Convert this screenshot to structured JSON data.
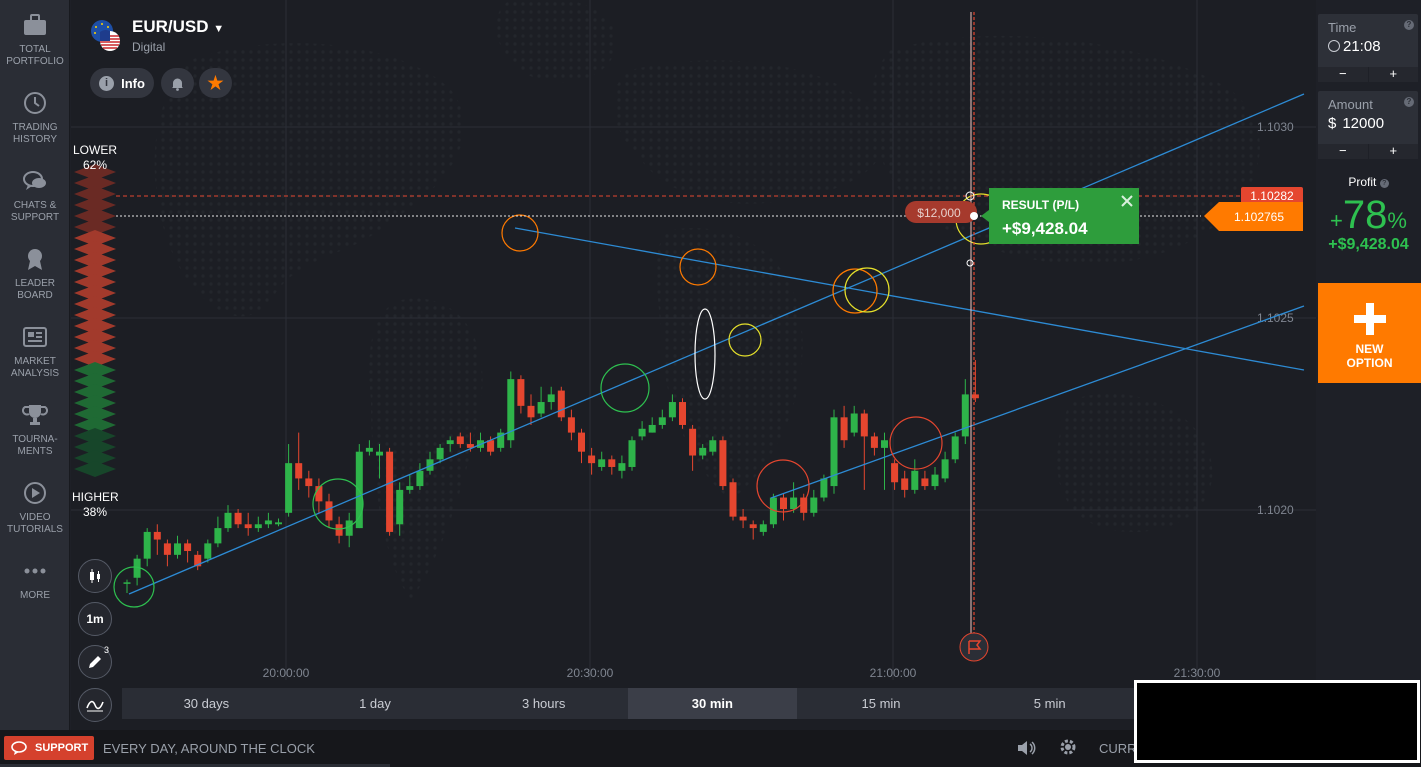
{
  "sidebar": {
    "items": [
      {
        "label": "Total Portfolio",
        "icon": "briefcase-icon"
      },
      {
        "label": "Trading History",
        "icon": "history-icon"
      },
      {
        "label": "Chats & Support",
        "icon": "chat-icon"
      },
      {
        "label": "Leader Board",
        "icon": "medal-icon"
      },
      {
        "label": "Market Analysis",
        "icon": "newspaper-icon"
      },
      {
        "label": "Tourna-ments",
        "icon": "trophy-icon"
      },
      {
        "label": "Video Tutorials",
        "icon": "play-icon"
      },
      {
        "label": "More",
        "icon": "more-icon"
      }
    ]
  },
  "asset": {
    "name": "EUR/USD",
    "type": "Digital",
    "info_label": "Info"
  },
  "sentiment": {
    "lower_label": "LOWER",
    "lower_pct": "62%",
    "higher_label": "HIGHER",
    "higher_pct": "38%"
  },
  "chart_tools": {
    "interval": "1m",
    "drawing_count": "3"
  },
  "price_axis": {
    "labels": [
      "1.1030",
      "1.1025",
      "1.1020"
    ],
    "strike_price": "1.10282",
    "current_price": "1.102765"
  },
  "time_axis": {
    "labels": [
      "20:00:00",
      "20:30:00",
      "21:00:00",
      "21:30:00"
    ]
  },
  "trade": {
    "amount_tag": "$12,000",
    "result_label": "RESULT (P/L)",
    "result_value": "+$9,428.04"
  },
  "right_panel": {
    "time_title": "Time",
    "time_value": "21:08",
    "amount_title": "Amount",
    "amount_currency": "$",
    "amount_value": "12000",
    "minus": "−",
    "plus": "+",
    "profit_title": "Profit",
    "profit_pct": "78",
    "profit_pct_sign": "%",
    "profit_plus": "+",
    "profit_value": "+$9,428.04",
    "new_option_label": "NEW OPTION"
  },
  "timeframes": [
    {
      "label": "30 days",
      "active": false
    },
    {
      "label": "1 day",
      "active": false
    },
    {
      "label": "3 hours",
      "active": false
    },
    {
      "label": "30 min",
      "active": true
    },
    {
      "label": "15 min",
      "active": false
    },
    {
      "label": "5 min",
      "active": false
    }
  ],
  "footer": {
    "support_label": "SUPPORT",
    "tagline": "EVERY DAY, AROUND THE CLOCK",
    "currency_label": "CURR"
  },
  "colors": {
    "up": "#2eb44a",
    "down": "#e5462f",
    "accent": "#ff7a00",
    "profit": "#2ec150",
    "trendline": "#2d8bd4"
  },
  "chart_data": {
    "type": "candlestick",
    "ylim": [
      1.10165,
      1.10345
    ],
    "candles": [
      {
        "o": 1.101805,
        "c": 1.101808,
        "h": 1.101815,
        "l": 1.10178
      },
      {
        "o": 1.10182,
        "c": 1.10187,
        "h": 1.10188,
        "l": 1.1018
      },
      {
        "o": 1.10187,
        "c": 1.10194,
        "h": 1.10195,
        "l": 1.10185
      },
      {
        "o": 1.10194,
        "c": 1.10192,
        "h": 1.10196,
        "l": 1.10188
      },
      {
        "o": 1.10191,
        "c": 1.10188,
        "h": 1.10192,
        "l": 1.10185
      },
      {
        "o": 1.10188,
        "c": 1.10191,
        "h": 1.10193,
        "l": 1.10187
      },
      {
        "o": 1.10191,
        "c": 1.10189,
        "h": 1.10192,
        "l": 1.10186
      },
      {
        "o": 1.10188,
        "c": 1.10185,
        "h": 1.10189,
        "l": 1.10184
      },
      {
        "o": 1.10187,
        "c": 1.10191,
        "h": 1.10192,
        "l": 1.10186
      },
      {
        "o": 1.10191,
        "c": 1.10195,
        "h": 1.10198,
        "l": 1.1019
      },
      {
        "o": 1.10195,
        "c": 1.10199,
        "h": 1.10201,
        "l": 1.10194
      },
      {
        "o": 1.10199,
        "c": 1.10196,
        "h": 1.102,
        "l": 1.10195
      },
      {
        "o": 1.10196,
        "c": 1.10195,
        "h": 1.10199,
        "l": 1.10193
      },
      {
        "o": 1.10195,
        "c": 1.10196,
        "h": 1.10198,
        "l": 1.10194
      },
      {
        "o": 1.10196,
        "c": 1.10197,
        "h": 1.10199,
        "l": 1.10195
      },
      {
        "o": 1.10196,
        "c": 1.101965,
        "h": 1.101975,
        "l": 1.101955
      },
      {
        "o": 1.10199,
        "c": 1.10212,
        "h": 1.10217,
        "l": 1.10198
      },
      {
        "o": 1.10212,
        "c": 1.10208,
        "h": 1.1022,
        "l": 1.10205
      },
      {
        "o": 1.10208,
        "c": 1.10206,
        "h": 1.1021,
        "l": 1.10203
      },
      {
        "o": 1.10206,
        "c": 1.10202,
        "h": 1.10208,
        "l": 1.10199
      },
      {
        "o": 1.10202,
        "c": 1.10197,
        "h": 1.10204,
        "l": 1.10195
      },
      {
        "o": 1.10196,
        "c": 1.10193,
        "h": 1.10198,
        "l": 1.10191
      },
      {
        "o": 1.10193,
        "c": 1.10197,
        "h": 1.10199,
        "l": 1.1019
      },
      {
        "o": 1.10195,
        "c": 1.10215,
        "h": 1.10217,
        "l": 1.10195
      },
      {
        "o": 1.10215,
        "c": 1.10216,
        "h": 1.10218,
        "l": 1.10214
      },
      {
        "o": 1.10214,
        "c": 1.10215,
        "h": 1.10217,
        "l": 1.10208
      },
      {
        "o": 1.10215,
        "c": 1.10194,
        "h": 1.10216,
        "l": 1.10193
      },
      {
        "o": 1.10196,
        "c": 1.10205,
        "h": 1.10207,
        "l": 1.10193
      },
      {
        "o": 1.10205,
        "c": 1.10206,
        "h": 1.10209,
        "l": 1.10204
      },
      {
        "o": 1.10206,
        "c": 1.1021,
        "h": 1.10212,
        "l": 1.10205
      },
      {
        "o": 1.1021,
        "c": 1.10213,
        "h": 1.10215,
        "l": 1.10209
      },
      {
        "o": 1.10213,
        "c": 1.10216,
        "h": 1.10217,
        "l": 1.10212
      },
      {
        "o": 1.10217,
        "c": 1.10218,
        "h": 1.10219,
        "l": 1.10215
      },
      {
        "o": 1.10219,
        "c": 1.10217,
        "h": 1.1022,
        "l": 1.10216
      },
      {
        "o": 1.10217,
        "c": 1.10216,
        "h": 1.1022,
        "l": 1.10215
      },
      {
        "o": 1.10216,
        "c": 1.10218,
        "h": 1.1022,
        "l": 1.10215
      },
      {
        "o": 1.10218,
        "c": 1.10215,
        "h": 1.10219,
        "l": 1.10214
      },
      {
        "o": 1.10216,
        "c": 1.1022,
        "h": 1.10221,
        "l": 1.10215
      },
      {
        "o": 1.10218,
        "c": 1.10234,
        "h": 1.10236,
        "l": 1.10216
      },
      {
        "o": 1.10234,
        "c": 1.10227,
        "h": 1.10235,
        "l": 1.10225
      },
      {
        "o": 1.10227,
        "c": 1.10224,
        "h": 1.1023,
        "l": 1.10222
      },
      {
        "o": 1.10225,
        "c": 1.10228,
        "h": 1.10232,
        "l": 1.10224
      },
      {
        "o": 1.10228,
        "c": 1.1023,
        "h": 1.10232,
        "l": 1.10226
      },
      {
        "o": 1.10231,
        "c": 1.10224,
        "h": 1.10232,
        "l": 1.10223
      },
      {
        "o": 1.10224,
        "c": 1.1022,
        "h": 1.10226,
        "l": 1.10218
      },
      {
        "o": 1.1022,
        "c": 1.10215,
        "h": 1.10221,
        "l": 1.10212
      },
      {
        "o": 1.10214,
        "c": 1.10212,
        "h": 1.10216,
        "l": 1.10209
      },
      {
        "o": 1.10211,
        "c": 1.10213,
        "h": 1.10215,
        "l": 1.1021
      },
      {
        "o": 1.10213,
        "c": 1.10211,
        "h": 1.10214,
        "l": 1.10209
      },
      {
        "o": 1.1021,
        "c": 1.10212,
        "h": 1.10214,
        "l": 1.10208
      },
      {
        "o": 1.10211,
        "c": 1.10218,
        "h": 1.10219,
        "l": 1.1021
      },
      {
        "o": 1.10219,
        "c": 1.10221,
        "h": 1.10223,
        "l": 1.10218
      },
      {
        "o": 1.1022,
        "c": 1.10222,
        "h": 1.10224,
        "l": 1.1022
      },
      {
        "o": 1.10222,
        "c": 1.10224,
        "h": 1.10226,
        "l": 1.10221
      },
      {
        "o": 1.10224,
        "c": 1.10228,
        "h": 1.1023,
        "l": 1.10223
      },
      {
        "o": 1.10228,
        "c": 1.10222,
        "h": 1.10229,
        "l": 1.10221
      },
      {
        "o": 1.10221,
        "c": 1.10214,
        "h": 1.10222,
        "l": 1.1021
      },
      {
        "o": 1.10214,
        "c": 1.10216,
        "h": 1.10217,
        "l": 1.10213
      },
      {
        "o": 1.10215,
        "c": 1.10218,
        "h": 1.10219,
        "l": 1.10214
      },
      {
        "o": 1.10218,
        "c": 1.10206,
        "h": 1.10219,
        "l": 1.10205
      },
      {
        "o": 1.10207,
        "c": 1.10198,
        "h": 1.10208,
        "l": 1.10197
      },
      {
        "o": 1.10198,
        "c": 1.10197,
        "h": 1.102,
        "l": 1.10195
      },
      {
        "o": 1.10196,
        "c": 1.10195,
        "h": 1.10197,
        "l": 1.10192
      },
      {
        "o": 1.10194,
        "c": 1.10196,
        "h": 1.10197,
        "l": 1.10193
      },
      {
        "o": 1.10196,
        "c": 1.10203,
        "h": 1.10204,
        "l": 1.10195
      },
      {
        "o": 1.10203,
        "c": 1.102,
        "h": 1.10204,
        "l": 1.10197
      },
      {
        "o": 1.102,
        "c": 1.10203,
        "h": 1.10207,
        "l": 1.10199
      },
      {
        "o": 1.10203,
        "c": 1.10199,
        "h": 1.10204,
        "l": 1.10197
      },
      {
        "o": 1.10199,
        "c": 1.10203,
        "h": 1.10205,
        "l": 1.10198
      },
      {
        "o": 1.10203,
        "c": 1.10208,
        "h": 1.10209,
        "l": 1.10202
      },
      {
        "o": 1.10206,
        "c": 1.10224,
        "h": 1.10226,
        "l": 1.10204
      },
      {
        "o": 1.10224,
        "c": 1.10218,
        "h": 1.10227,
        "l": 1.10216
      },
      {
        "o": 1.1022,
        "c": 1.10225,
        "h": 1.10227,
        "l": 1.10219
      },
      {
        "o": 1.10225,
        "c": 1.10219,
        "h": 1.10226,
        "l": 1.10205
      },
      {
        "o": 1.10219,
        "c": 1.10216,
        "h": 1.1022,
        "l": 1.10214
      },
      {
        "o": 1.10216,
        "c": 1.10218,
        "h": 1.1022,
        "l": 1.10205
      },
      {
        "o": 1.10212,
        "c": 1.10207,
        "h": 1.10213,
        "l": 1.10205
      },
      {
        "o": 1.10208,
        "c": 1.10205,
        "h": 1.1021,
        "l": 1.10203
      },
      {
        "o": 1.10205,
        "c": 1.1021,
        "h": 1.10213,
        "l": 1.10204
      },
      {
        "o": 1.10208,
        "c": 1.10206,
        "h": 1.1021,
        "l": 1.10205
      },
      {
        "o": 1.10206,
        "c": 1.10209,
        "h": 1.10211,
        "l": 1.10205
      },
      {
        "o": 1.10208,
        "c": 1.10213,
        "h": 1.10215,
        "l": 1.10207
      },
      {
        "o": 1.10213,
        "c": 1.10219,
        "h": 1.1022,
        "l": 1.10212
      },
      {
        "o": 1.10219,
        "c": 1.1023,
        "h": 1.10234,
        "l": 1.10217
      },
      {
        "o": 1.1023,
        "c": 1.10229,
        "h": 1.10239,
        "l": 1.10228
      }
    ]
  }
}
